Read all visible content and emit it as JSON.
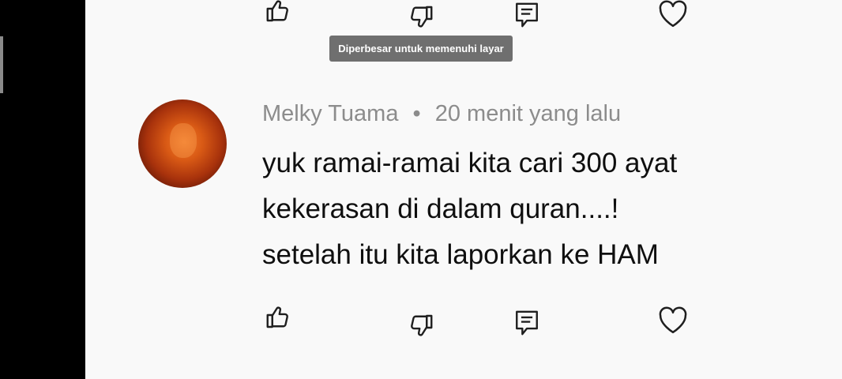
{
  "toast": {
    "text": "Diperbesar untuk memenuhi layar"
  },
  "comment": {
    "author": "Melky Tuama",
    "separator": "•",
    "time": "20 menit yang lalu",
    "lines": [
      "yuk ramai-ramai kita cari 300 ayat",
      "kekerasan di dalam quran....!",
      "setelah itu kita laporkan ke HAM"
    ]
  },
  "icons": {
    "like": "thumbs-up-icon",
    "dislike": "thumbs-down-icon",
    "reply": "reply-comment-icon",
    "heart": "heart-icon"
  },
  "colors": {
    "background": "#f9f9f9",
    "text": "#0f0f0f",
    "meta_text": "#8c8c8c",
    "toast_bg": "#6f6f6f"
  }
}
